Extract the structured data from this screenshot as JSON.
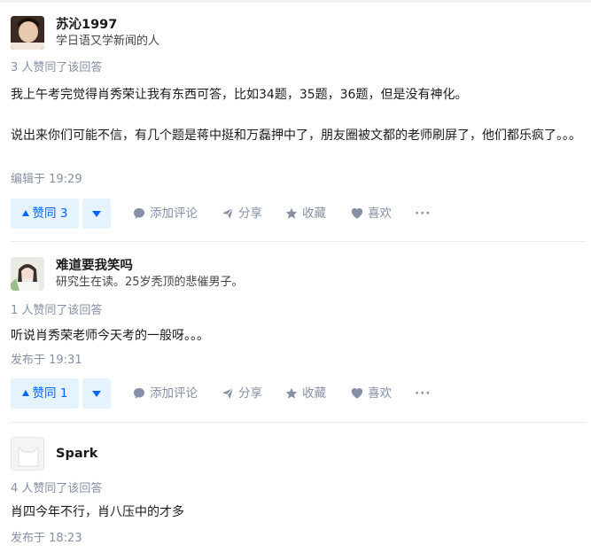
{
  "answers": [
    {
      "author_name": "苏沁1997",
      "author_headline": "学日语又学新闻的人",
      "votes_text": "3 人赞同了该回答",
      "paragraphs": [
        "我上午考完觉得肖秀荣让我有东西可答，比如34题，35题，36题，但是没有神化。",
        "说出来你们可能不信，有几个题是蒋中挺和万磊押中了，朋友圈被文都的老师刷屏了，他们都乐疯了。。。"
      ],
      "time_text": "编辑于 19:29",
      "vote_label": "赞同 3",
      "show_actions": true
    },
    {
      "author_name": "难道要我笑吗",
      "author_headline": "研究生在读。25岁秃顶的悲催男子。",
      "votes_text": "1 人赞同了该回答",
      "paragraphs": [
        "听说肖秀荣老师今天考的一般呀。。。"
      ],
      "time_text": "发布于 19:31",
      "vote_label": "赞同 1",
      "show_actions": true
    },
    {
      "author_name": "Spark",
      "author_headline": "",
      "votes_text": "4 人赞同了该回答",
      "paragraphs": [
        "肖四今年不行，肖八压中的才多"
      ],
      "time_text": "发布于 18:23",
      "show_actions": false
    }
  ],
  "actions": {
    "comment": "添加评论",
    "share": "分享",
    "favorite": "收藏",
    "like": "喜欢",
    "more": "···"
  },
  "colors": {
    "accent": "#0066ff",
    "accent_bg": "#e5f2ff",
    "meta": "#8590a6"
  },
  "icons": [
    "comment-icon",
    "share-icon",
    "star-icon",
    "heart-icon",
    "more-icon",
    "vote-up-icon",
    "vote-down-icon"
  ]
}
